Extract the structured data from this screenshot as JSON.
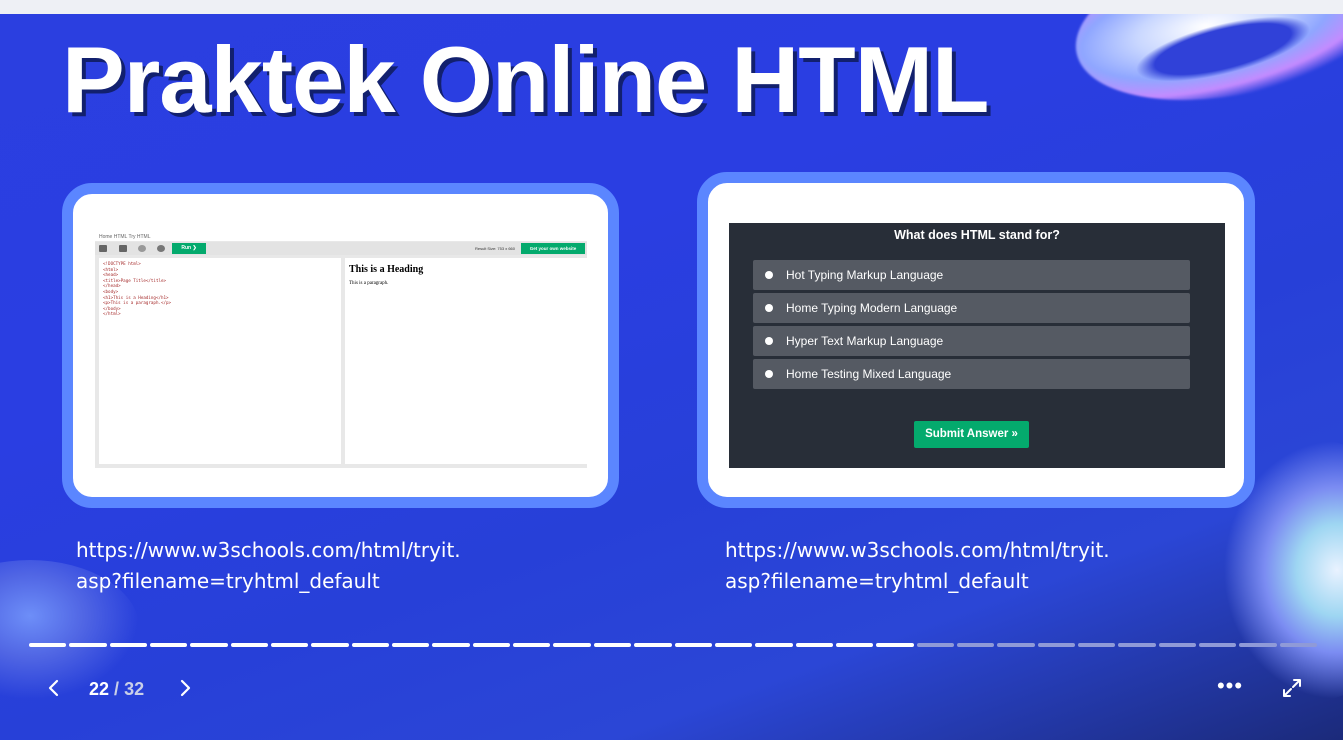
{
  "slide": {
    "title": "Praktek Online HTML",
    "left_url": "https://www.w3schools.com/html/tryit.\nasp?filename=tryhtml_default",
    "right_url": "https://www.w3schools.com/html/tryit.\nasp?filename=tryhtml_default"
  },
  "tryit": {
    "breadcrumb": "Home   HTML   Try HTML",
    "run_label": "Run ❯",
    "result_size": "Result Size: 753 x 660",
    "own_website_label": "Get your own website",
    "code_lines": [
      "<!DOCTYPE html>",
      "<html>",
      "<head>",
      "<title>Page Title</title>",
      "</head>",
      "<body>",
      "",
      "<h1>This is a Heading</h1>",
      "<p>This is a paragraph.</p>",
      "",
      "</body>",
      "</html>"
    ],
    "result_heading": "This is a Heading",
    "result_paragraph": "This is a paragraph."
  },
  "quiz": {
    "question": "What does HTML stand for?",
    "options": [
      "Hot Typing Markup Language",
      "Home Typing Modern Language",
      "Hyper Text Markup Language",
      "Home Testing Mixed Language"
    ],
    "submit_label": "Submit Answer »"
  },
  "player": {
    "current_page": "22",
    "separator": "/",
    "total_pages": "32",
    "progress_fraction": 0.6875,
    "segment_count": 32,
    "completed_segments": 22,
    "more_label": "•••",
    "colors": {
      "segment_done": "#ffffff",
      "segment_todo": "#8f9ad8"
    }
  }
}
